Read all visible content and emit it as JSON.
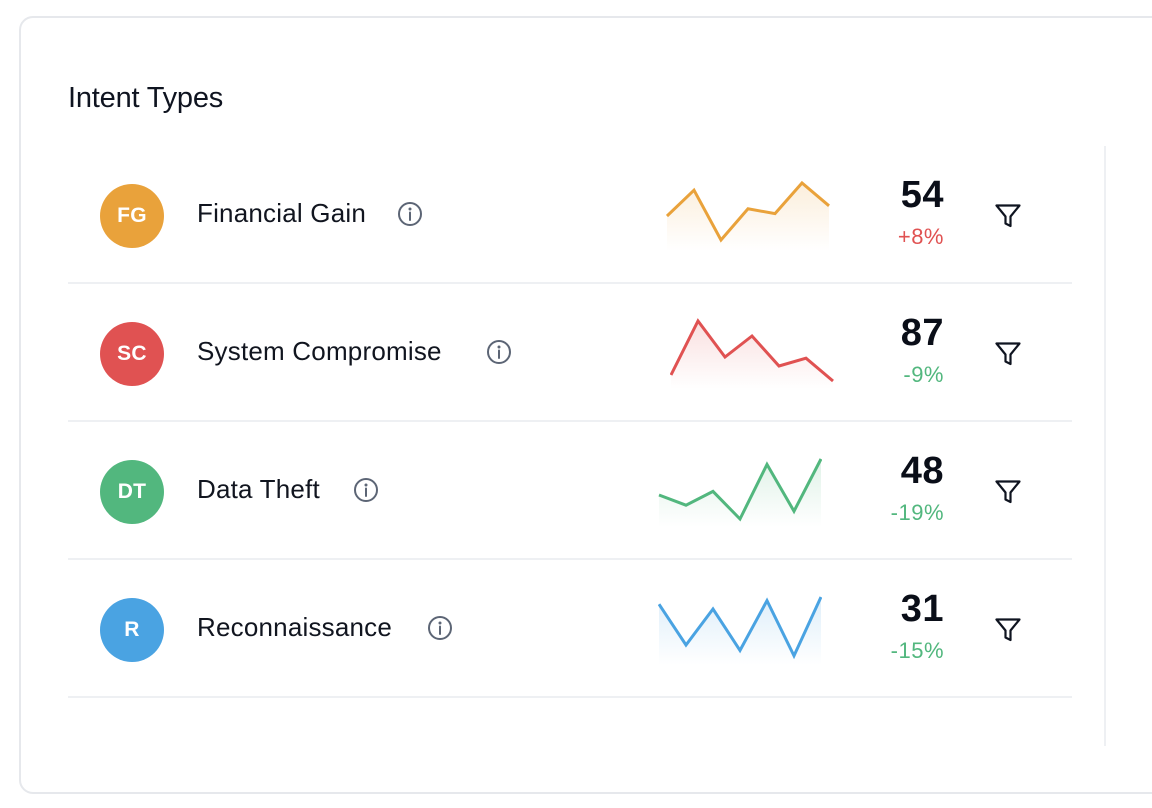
{
  "title": "Intent Types",
  "colors": {
    "financial": "#e9a23b",
    "compromise": "#e05252",
    "theft": "#52b77e",
    "recon": "#4aa3e2",
    "positive_change": "#e05252",
    "negative_change": "#52b77e"
  },
  "rows": [
    {
      "initials": "FG",
      "label": "Financial Gain",
      "value": "54",
      "change": "+8%",
      "color": "#e9a23b",
      "change_color": "#e05252",
      "info_icon": "info-circle-icon",
      "action_icon": "filter-icon",
      "trend": [
        0.45,
        0.88,
        0.05,
        0.57,
        0.49,
        1.0,
        0.62
      ]
    },
    {
      "initials": "SC",
      "label": "System Compromise",
      "value": "87",
      "change": "-9%",
      "color": "#e05252",
      "change_color": "#52b77e",
      "info_icon": "info-circle-icon",
      "action_icon": "filter-icon",
      "trend": [
        0.1,
        1.0,
        0.4,
        0.75,
        0.25,
        0.38,
        0.0
      ]
    },
    {
      "initials": "DT",
      "label": "Data Theft",
      "value": "48",
      "change": "-19%",
      "color": "#52b77e",
      "change_color": "#52b77e",
      "info_icon": "info-circle-icon",
      "action_icon": "filter-icon",
      "trend": [
        0.4,
        0.23,
        0.46,
        0.0,
        0.91,
        0.13,
        1.0
      ]
    },
    {
      "initials": "R",
      "label": "Reconnaissance",
      "value": "31",
      "change": "-15%",
      "color": "#4aa3e2",
      "change_color": "#52b77e",
      "info_icon": "info-circle-icon",
      "action_icon": "filter-icon",
      "trend": [
        0.88,
        0.2,
        0.8,
        0.11,
        0.94,
        0.02,
        1.0
      ]
    }
  ]
}
